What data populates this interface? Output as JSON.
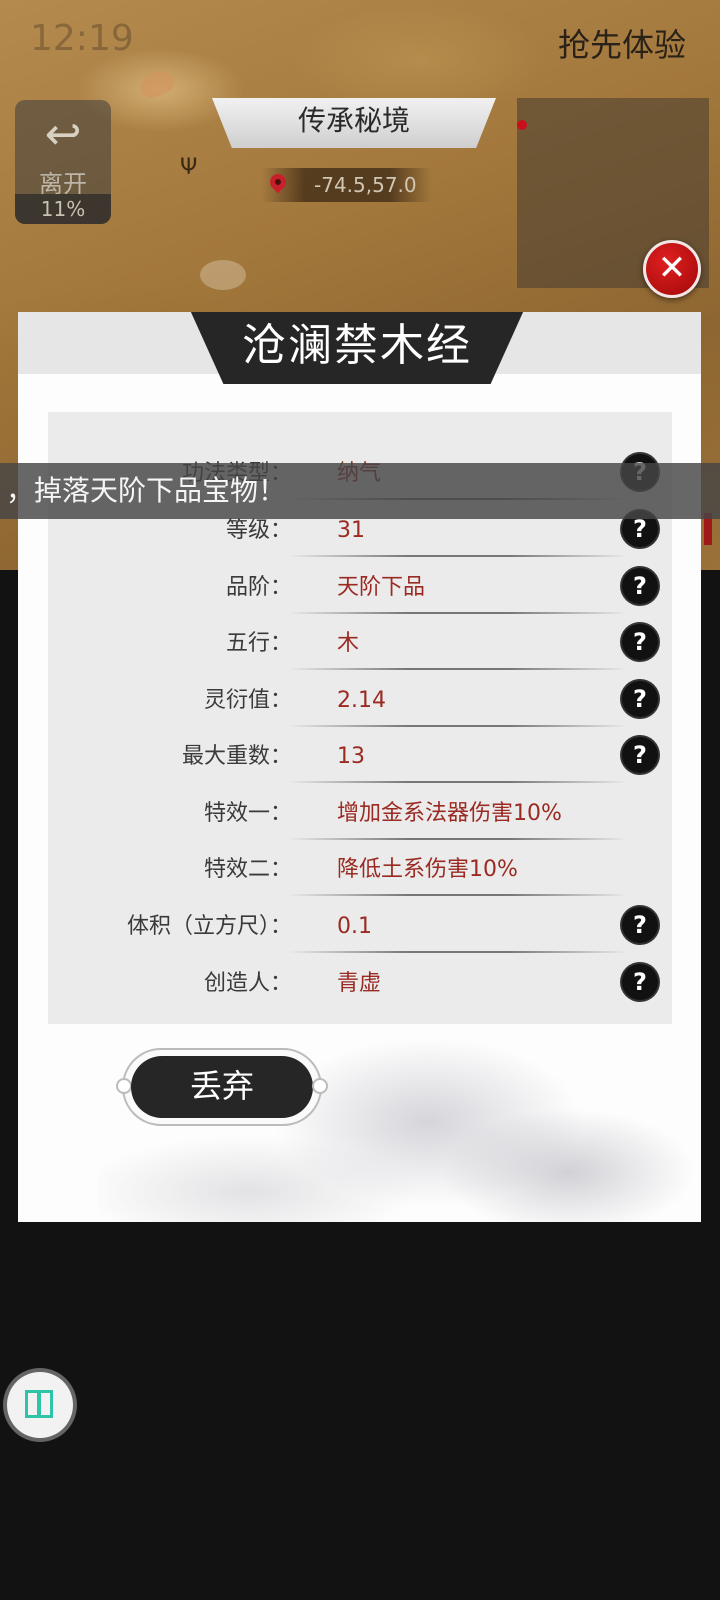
{
  "status_bar": {
    "time": "12:19"
  },
  "top_right_label": "抢先体验",
  "leave": {
    "arrow_icon": "↩",
    "label": "离开",
    "progress": "11%"
  },
  "realm": {
    "title": "传承秘境",
    "coordinates": "-74.5,57.0"
  },
  "close_icon": "✕",
  "notice": "，掉落天阶下品宝物！",
  "dialog": {
    "title": "沧澜禁木经",
    "help_icon": "?",
    "rows": [
      {
        "label": "功法类型：",
        "value": "纳气",
        "has_help": true
      },
      {
        "label": "等级：",
        "value": "31",
        "has_help": true
      },
      {
        "label": "品阶：",
        "value": "天阶下品",
        "has_help": true
      },
      {
        "label": "五行：",
        "value": "木",
        "has_help": true
      },
      {
        "label": "灵衍值：",
        "value": "2.14",
        "has_help": true
      },
      {
        "label": "最大重数：",
        "value": "13",
        "has_help": true
      },
      {
        "label": "特效一：",
        "value": "增加金系法器伤害10%",
        "has_help": false
      },
      {
        "label": "特效二：",
        "value": "降低土系伤害10%",
        "has_help": false
      },
      {
        "label": "体积（立方尺）：",
        "value": "0.1",
        "has_help": true
      },
      {
        "label": "创造人：",
        "value": "青虚",
        "has_help": true
      }
    ],
    "discard_label": "丢弃"
  },
  "colors": {
    "value_text": "#9a2a22",
    "close_red": "#c01010",
    "accent_teal": "#2fc4a8"
  }
}
